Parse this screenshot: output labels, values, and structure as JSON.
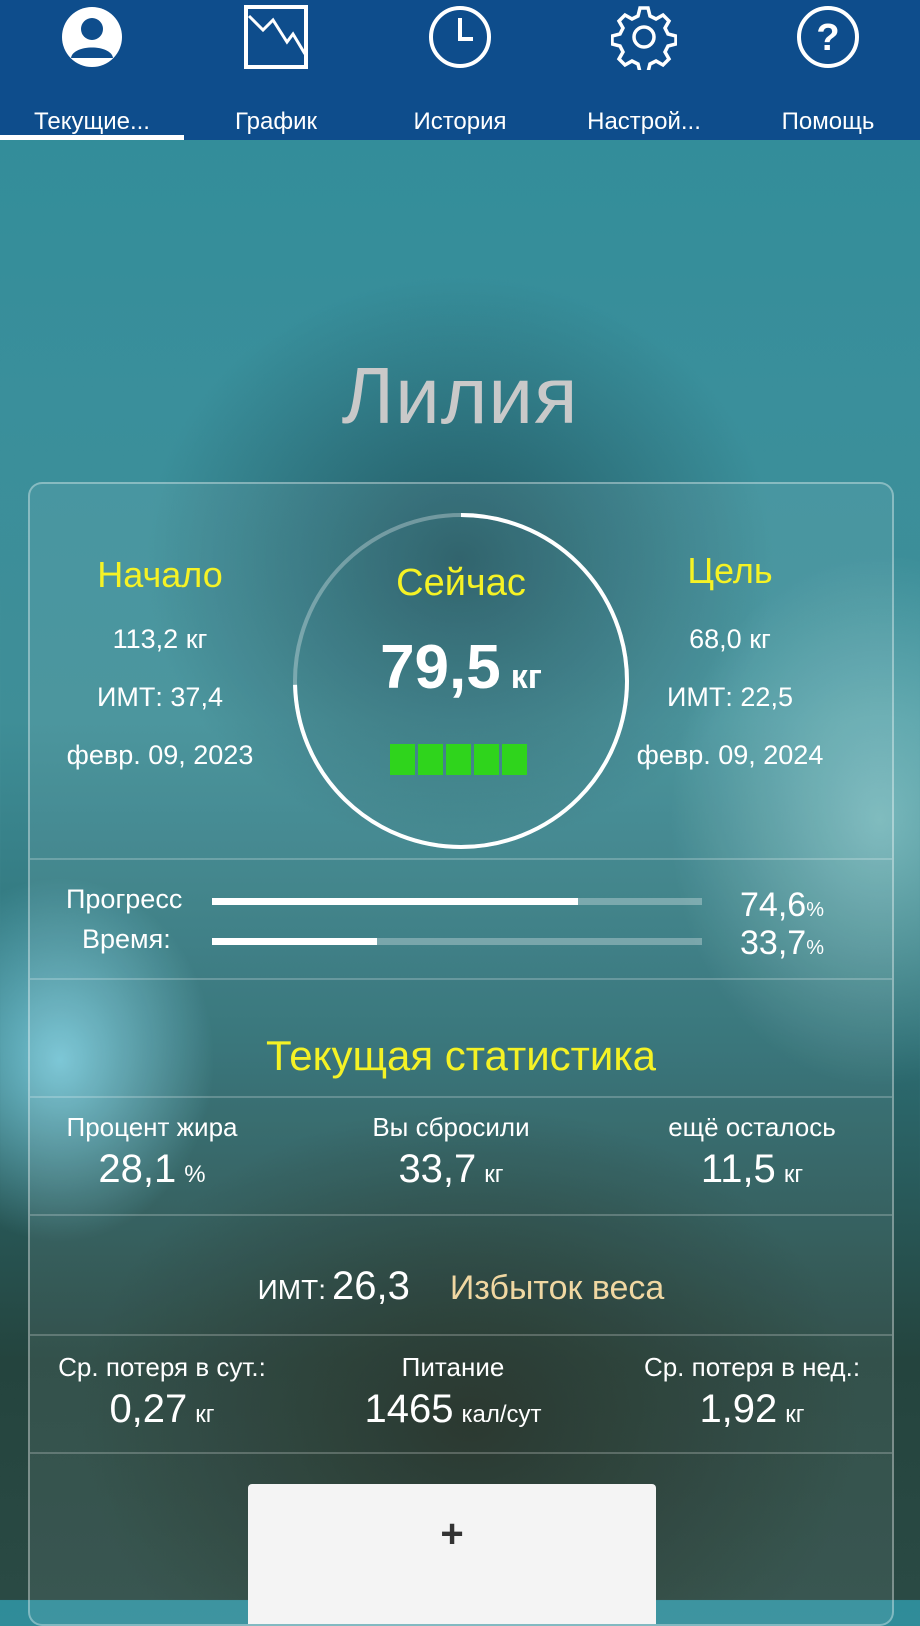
{
  "tabs": [
    {
      "label": "Текущие...",
      "icon": "profile-icon"
    },
    {
      "label": "График",
      "icon": "chart-icon"
    },
    {
      "label": "История",
      "icon": "clock-icon"
    },
    {
      "label": "Настрой...",
      "icon": "gear-icon"
    },
    {
      "label": "Помощь",
      "icon": "help-icon"
    }
  ],
  "active_tab": 0,
  "user_name": "Лилия",
  "start": {
    "title": "Начало",
    "weight": "113,2 кг",
    "bmi": "ИМТ: 37,4",
    "date": "февр. 09, 2023"
  },
  "now": {
    "title": "Сейчас",
    "value": "79,5",
    "unit": "кг",
    "ring_progress": 0.746
  },
  "goal": {
    "title": "Цель",
    "weight": "68,0 кг",
    "bmi": "ИМТ: 22,5",
    "date": "февр. 09, 2024"
  },
  "progress": {
    "progress_label": "Прогресс",
    "progress_value": "74,6",
    "progress_fraction": 0.746,
    "time_label": "Время:",
    "time_value": "33,7",
    "time_fraction": 0.337,
    "percent_sign": "%"
  },
  "stats": {
    "title": "Текущая статистика",
    "fat": {
      "label": "Процент жира",
      "value": "28,1",
      "unit": "%"
    },
    "lost": {
      "label": "Вы сбросили",
      "value": "33,7",
      "unit": "кг"
    },
    "remaining": {
      "label": "ещё осталось",
      "value": "11,5",
      "unit": "кг"
    },
    "bmi": {
      "label": "ИМТ:",
      "value": "26,3",
      "category": "Избыток веса"
    },
    "daily_loss": {
      "label": "Ср. потеря в сут.:",
      "value": "0,27",
      "unit": "кг"
    },
    "nutrition": {
      "label": "Питание",
      "value": "1465",
      "unit": "кал/сут"
    },
    "weekly_loss": {
      "label": "Ср. потеря в нед.:",
      "value": "1,92",
      "unit": "кг"
    }
  },
  "add_button": {
    "label": "+"
  },
  "colors": {
    "nav_bg": "#0e4d8c",
    "accent_yellow": "#f5f225",
    "progress_green": "#2fd41c",
    "category": "#f0d7a2"
  }
}
